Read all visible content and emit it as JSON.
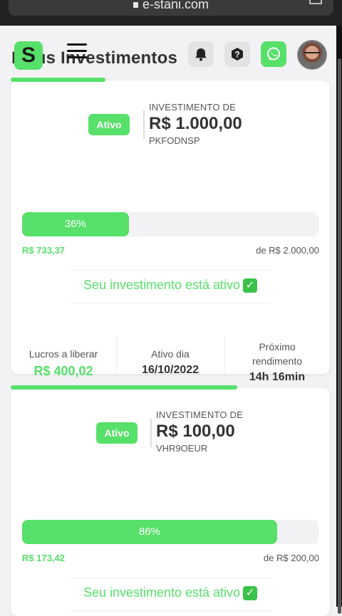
{
  "browser": {
    "url": "e-stani.com"
  },
  "header": {
    "title": "Meus Investimentos",
    "logo_letter": "S"
  },
  "investments": [
    {
      "status": "Ativo",
      "label": "INVESTIMENTO DE",
      "amount": "R$ 1.000,00",
      "code": "PKFODNSP",
      "progress_percent": 36,
      "progress_label": "36%",
      "profit_current": "R$ 733,37",
      "profit_target": "de R$ 2.000,00",
      "status_message": "Seu investimento está ativo",
      "stats": {
        "profit_label": "Lucros a liberar",
        "profit_value": "R$ 400,02",
        "active_label": "Ativo dia",
        "active_value": "16/10/2022",
        "next_label": "Próximo rendimento",
        "next_value": "14h 16min"
      }
    },
    {
      "status": "Ativo",
      "label": "INVESTIMENTO DE",
      "amount": "R$ 100,00",
      "code": "VHR9OEUR",
      "progress_percent": 86,
      "progress_label": "86%",
      "profit_current": "R$ 173,42",
      "profit_target": "de R$ 200,00",
      "status_message": "Seu investimento está ativo"
    }
  ],
  "icons": {
    "bell": "bell-icon",
    "help": "help-icon",
    "whatsapp": "whatsapp-icon",
    "menu": "menu-icon",
    "check": "check-icon",
    "lock": "lock-icon",
    "share": "share-icon"
  },
  "colors": {
    "accent": "#57e06a",
    "background": "#f2f2f4",
    "text": "#333333"
  }
}
